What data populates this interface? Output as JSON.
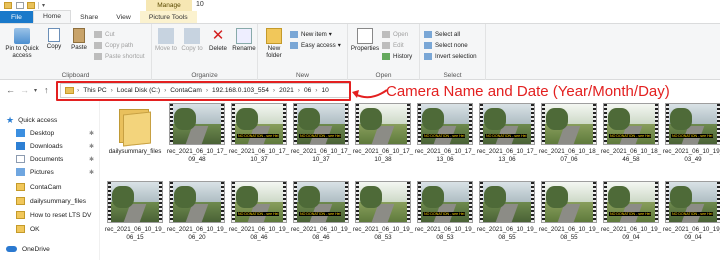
{
  "window": {
    "manage_label": "Manage",
    "title": "10"
  },
  "tabs": [
    {
      "label": "File"
    },
    {
      "label": "Home"
    },
    {
      "label": "Share"
    },
    {
      "label": "View"
    },
    {
      "label": "Picture Tools"
    }
  ],
  "ribbon": {
    "clipboard": {
      "pin_label": "Pin to Quick access",
      "copy_label": "Copy",
      "paste_label": "Paste",
      "cut_label": "Cut",
      "copy_path_label": "Copy path",
      "paste_shortcut_label": "Paste shortcut",
      "group_label": "Clipboard"
    },
    "organize": {
      "move_to_label": "Move to",
      "copy_to_label": "Copy to",
      "delete_label": "Delete",
      "rename_label": "Rename",
      "group_label": "Organize"
    },
    "new": {
      "new_folder_label": "New folder",
      "new_item_label": "New item",
      "easy_access_label": "Easy access",
      "group_label": "New"
    },
    "open": {
      "properties_label": "Properties",
      "open_label": "Open",
      "edit_label": "Edit",
      "history_label": "History",
      "group_label": "Open"
    },
    "select": {
      "select_all_label": "Select all",
      "select_none_label": "Select none",
      "invert_selection_label": "Invert selection",
      "group_label": "Select"
    }
  },
  "address": {
    "crumbs": [
      "This PC",
      "Local Disk (C:)",
      "ContaCam",
      "192.168.0.103_554",
      "2021",
      "06",
      "10"
    ]
  },
  "annotation": {
    "text": "Camera Name and Date (Year/Month/Day)",
    "color": "#e32020"
  },
  "sidebar": {
    "items": [
      {
        "label": "Quick access",
        "icon": "star-icon"
      },
      {
        "label": "Desktop",
        "icon": "desktop-icon",
        "pinned": true
      },
      {
        "label": "Downloads",
        "icon": "download-icon",
        "pinned": true
      },
      {
        "label": "Documents",
        "icon": "document-icon",
        "pinned": true
      },
      {
        "label": "Pictures",
        "icon": "picture-icon",
        "pinned": true
      },
      {
        "label": "ContaCam",
        "icon": "folder-icon"
      },
      {
        "label": "dailysummary_files",
        "icon": "folder-icon"
      },
      {
        "label": "How to reset LTS DV",
        "icon": "folder-icon"
      },
      {
        "label": "OK",
        "icon": "folder-icon"
      },
      {
        "label": "OneDrive",
        "icon": "cloud-icon"
      }
    ]
  },
  "files": {
    "row1": [
      {
        "name": "dailysummary_files",
        "type": "folder"
      },
      {
        "name": "rec_2021_06_10_17_09_48",
        "type": "video"
      },
      {
        "name": "rec_2021_06_10_17_10_37",
        "type": "video"
      },
      {
        "name": "rec_2021_06_10_17_10_37",
        "type": "video"
      },
      {
        "name": "rec_2021_06_10_17_10_38",
        "type": "video"
      },
      {
        "name": "rec_2021_06_10_17_13_06",
        "type": "video"
      },
      {
        "name": "rec_2021_06_10_17_13_06",
        "type": "video"
      },
      {
        "name": "rec_2021_06_10_18_07_06",
        "type": "video"
      },
      {
        "name": "rec_2021_06_10_18_46_58",
        "type": "video"
      },
      {
        "name": "rec_2021_06_10_19_03_49",
        "type": "video"
      }
    ],
    "row2": [
      {
        "name": "rec_2021_06_10_19_06_15",
        "type": "video"
      },
      {
        "name": "rec_2021_06_10_19_06_20",
        "type": "video"
      },
      {
        "name": "rec_2021_06_10_19_08_46",
        "type": "video"
      },
      {
        "name": "rec_2021_06_10_19_08_46",
        "type": "video"
      },
      {
        "name": "rec_2021_06_10_19_08_53",
        "type": "video"
      },
      {
        "name": "rec_2021_06_10_19_08_53",
        "type": "video"
      },
      {
        "name": "rec_2021_06_10_19_08_55",
        "type": "video"
      },
      {
        "name": "rec_2021_06_10_19_08_55",
        "type": "video"
      },
      {
        "name": "rec_2021_06_10_19_09_04",
        "type": "video"
      },
      {
        "name": "rec_2021_06_10_19_09_04",
        "type": "video"
      }
    ],
    "osd_text": "NO DONATION - see Hel"
  }
}
